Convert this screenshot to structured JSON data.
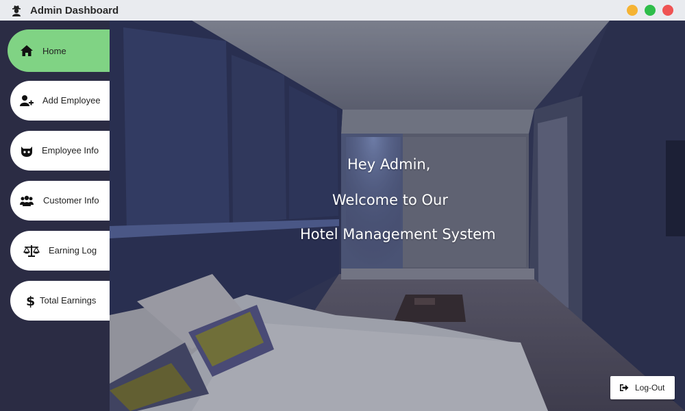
{
  "window": {
    "title": "Admin Dashboard",
    "app_icon": "spy-icon",
    "controls": [
      "minimize",
      "maximize",
      "close"
    ]
  },
  "sidebar": {
    "items": [
      {
        "label": "Home",
        "icon": "home-icon",
        "active": true
      },
      {
        "label": "Add Employee",
        "icon": "user-plus-icon",
        "active": false
      },
      {
        "label": "Employee Info",
        "icon": "github-cat-icon",
        "active": false
      },
      {
        "label": "Customer Info",
        "icon": "users-icon",
        "active": false
      },
      {
        "label": "Earning Log",
        "icon": "balance-scale-icon",
        "active": false
      },
      {
        "label": "Total Earnings",
        "icon": "dollar-icon",
        "active": false
      }
    ]
  },
  "main": {
    "background": "hotel-bedroom-photo",
    "greeting": "Hey Admin,",
    "welcome_line": "Welcome to Our",
    "system_name": "Hotel Management System"
  },
  "logout": {
    "label": "Log-Out",
    "icon": "sign-out-icon"
  },
  "colors": {
    "sidebar_bg": "#2b2c44",
    "active_item": "#80d384",
    "titlebar_bg": "#e9ebef",
    "min_button": "#f5b333",
    "max_button": "#2ebd4a",
    "close_button": "#ef5353"
  }
}
